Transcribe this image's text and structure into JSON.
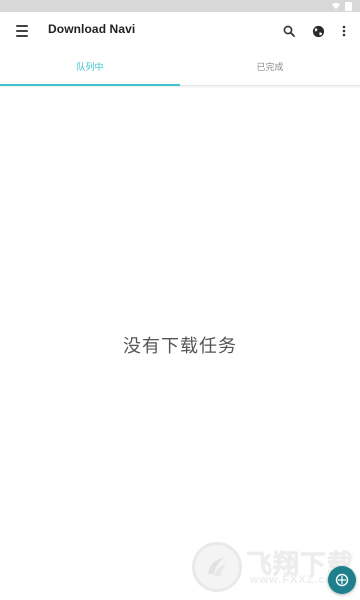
{
  "app_bar": {
    "title": "Download Navi",
    "icons": [
      "menu-icon",
      "search-icon",
      "globe-icon",
      "more-vert-icon"
    ]
  },
  "tabs": [
    {
      "label": "队列中",
      "active": true
    },
    {
      "label": "已完成",
      "active": false
    }
  ],
  "main": {
    "empty_message": "没有下载任务"
  },
  "watermark": {
    "brand": "飞翔下载",
    "url": "www.FXXZ.com"
  },
  "colors": {
    "accent": "#3cc3cf",
    "status_bar": "#d8d8d8",
    "text_primary": "#212121",
    "empty_text": "#555555",
    "fab": "#1f7f8c"
  }
}
